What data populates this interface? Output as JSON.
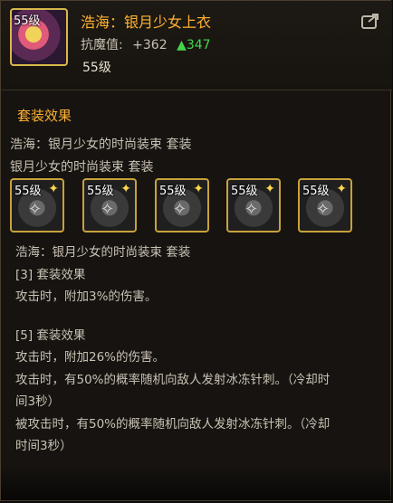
{
  "item": {
    "icon_level": "55级",
    "title": "浩海：银月少女上衣",
    "stat_label": "抗魔值:",
    "stat_plus": "+362",
    "stat_increase": "▲347",
    "level": "55级"
  },
  "set": {
    "section_title": "套装效果",
    "line1": "浩海：银月少女的时尚装束 套装",
    "line2": "银月少女的时尚装束 套装",
    "pieces": [
      {
        "level": "55级"
      },
      {
        "level": "55级"
      },
      {
        "level": "55级"
      },
      {
        "level": "55级"
      },
      {
        "level": "55级"
      }
    ],
    "bonus_header": "浩海：银月少女的时尚装束 套装",
    "bonus3_title": "[3] 套装效果",
    "bonus3_text": "攻击时，附加3%的伤害。",
    "bonus5_title": "[5] 套装效果",
    "bonus5_text1": "攻击时，附加26%的伤害。",
    "bonus5_text2a": "攻击时，有50%的概率随机向敌人发射冰冻针刺。（冷却时",
    "bonus5_text2b": "间3秒）",
    "bonus5_text3a": "被攻击时，有50%的概率随机向敌人发射冰冻针刺。（冷却",
    "bonus5_text3b": "时间3秒）"
  },
  "icons": {
    "share": "share-icon",
    "star": "star-icon",
    "sparkle": "sparkle-icon"
  },
  "colors": {
    "title": "#ffb232",
    "increase": "#43d64b",
    "border": "#c8a23a"
  }
}
